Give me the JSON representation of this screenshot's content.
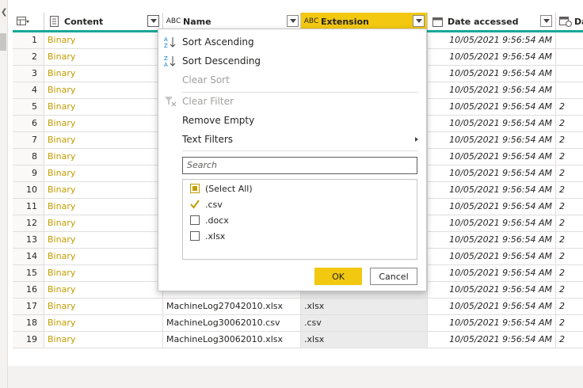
{
  "header": {
    "columns": [
      {
        "label": "Content",
        "icon": "table-icon"
      },
      {
        "label": "Name",
        "icon": "abc-text-icon"
      },
      {
        "label": "Extension",
        "icon": "abc-text-icon"
      },
      {
        "label": "Date accessed",
        "icon": "calendar-icon"
      },
      {
        "label": "Da",
        "icon": "calendar-clock-icon"
      }
    ],
    "type_abc": "ABC"
  },
  "rows": [
    {
      "idx": "1",
      "content": "Binary",
      "name": "",
      "ext": "",
      "date": "10/05/2021 9:56:54 AM",
      "date2": ""
    },
    {
      "idx": "2",
      "content": "Binary",
      "name": "",
      "ext": "",
      "date": "10/05/2021 9:56:54 AM",
      "date2": ""
    },
    {
      "idx": "3",
      "content": "Binary",
      "name": "",
      "ext": "",
      "date": "10/05/2021 9:56:54 AM",
      "date2": ""
    },
    {
      "idx": "4",
      "content": "Binary",
      "name": "",
      "ext": "",
      "date": "10/05/2021 9:56:54 AM",
      "date2": ""
    },
    {
      "idx": "5",
      "content": "Binary",
      "name": "",
      "ext": "",
      "date": "10/05/2021 9:56:54 AM",
      "date2": "2"
    },
    {
      "idx": "6",
      "content": "Binary",
      "name": "",
      "ext": "",
      "date": "10/05/2021 9:56:54 AM",
      "date2": "2"
    },
    {
      "idx": "7",
      "content": "Binary",
      "name": "",
      "ext": "",
      "date": "10/05/2021 9:56:54 AM",
      "date2": "2"
    },
    {
      "idx": "8",
      "content": "Binary",
      "name": "",
      "ext": "",
      "date": "10/05/2021 9:56:54 AM",
      "date2": "2"
    },
    {
      "idx": "9",
      "content": "Binary",
      "name": "",
      "ext": "",
      "date": "10/05/2021 9:56:54 AM",
      "date2": "2"
    },
    {
      "idx": "10",
      "content": "Binary",
      "name": "",
      "ext": "",
      "date": "10/05/2021 9:56:54 AM",
      "date2": "2"
    },
    {
      "idx": "11",
      "content": "Binary",
      "name": "",
      "ext": "",
      "date": "10/05/2021 9:56:54 AM",
      "date2": "2"
    },
    {
      "idx": "12",
      "content": "Binary",
      "name": "",
      "ext": "",
      "date": "10/05/2021 9:56:54 AM",
      "date2": "2"
    },
    {
      "idx": "13",
      "content": "Binary",
      "name": "",
      "ext": "",
      "date": "10/05/2021 9:56:54 AM",
      "date2": "2"
    },
    {
      "idx": "14",
      "content": "Binary",
      "name": "",
      "ext": "",
      "date": "10/05/2021 9:56:54 AM",
      "date2": "2"
    },
    {
      "idx": "15",
      "content": "Binary",
      "name": "",
      "ext": "",
      "date": "10/05/2021 9:56:54 AM",
      "date2": "2"
    },
    {
      "idx": "16",
      "content": "Binary",
      "name": "",
      "ext": "",
      "date": "10/05/2021 9:56:54 AM",
      "date2": "2"
    },
    {
      "idx": "17",
      "content": "Binary",
      "name": "MachineLog27042010.xlsx",
      "ext": ".xlsx",
      "date": "10/05/2021 9:56:54 AM",
      "date2": "2"
    },
    {
      "idx": "18",
      "content": "Binary",
      "name": "MachineLog30062010.csv",
      "ext": ".csv",
      "date": "10/05/2021 9:56:54 AM",
      "date2": "2"
    },
    {
      "idx": "19",
      "content": "Binary",
      "name": "MachineLog30062010.xlsx",
      "ext": ".xlsx",
      "date": "10/05/2021 9:56:54 AM",
      "date2": "2"
    }
  ],
  "menu": {
    "sort_asc": "Sort Ascending",
    "sort_desc": "Sort Descending",
    "clear_sort": "Clear Sort",
    "clear_filter": "Clear Filter",
    "remove_empty": "Remove Empty",
    "text_filters": "Text Filters",
    "search_placeholder": "Search",
    "items": [
      {
        "label": "(Select All)",
        "state": "partial"
      },
      {
        "label": ".csv",
        "state": "checked"
      },
      {
        "label": ".docx",
        "state": "unchecked"
      },
      {
        "label": ".xlsx",
        "state": "unchecked"
      }
    ],
    "ok": "OK",
    "cancel": "Cancel"
  },
  "colors": {
    "accent": "#f2c811",
    "teal": "#1aa79a",
    "binary_text": "#c19c00"
  }
}
